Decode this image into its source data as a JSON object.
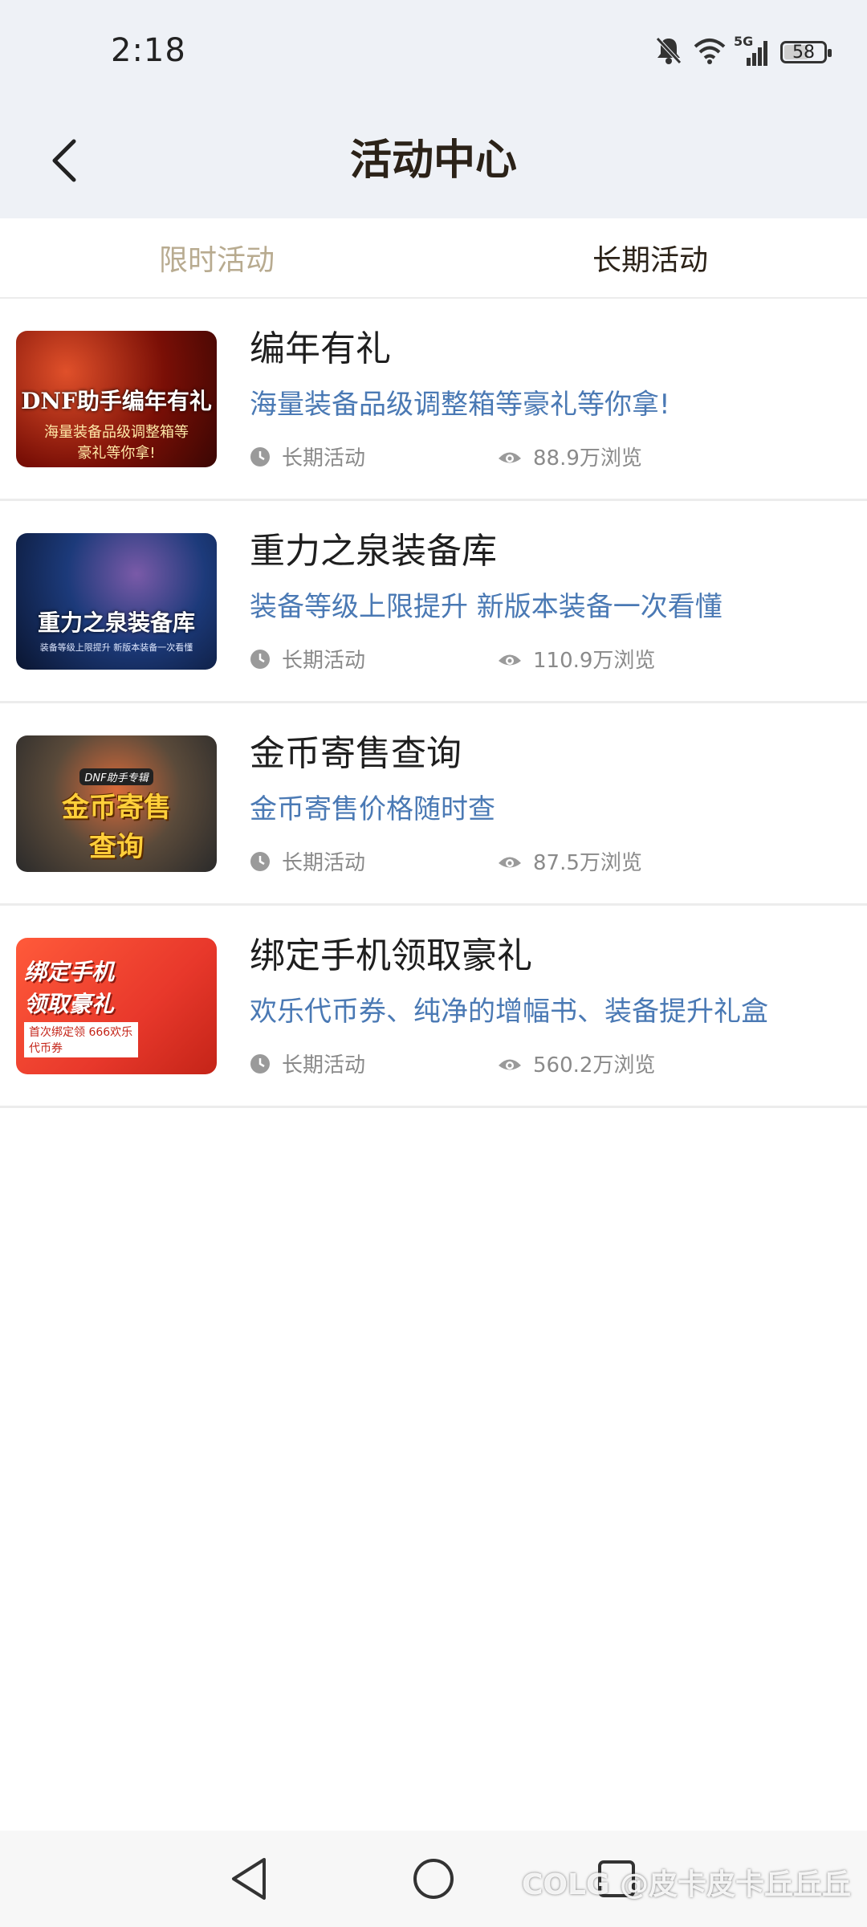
{
  "status": {
    "time": "2:18",
    "network": "5G",
    "battery": "58",
    "battery_level": 0.58
  },
  "header": {
    "title": "活动中心",
    "back_icon": "chevron-left-icon"
  },
  "tabs": [
    {
      "label": "限时活动",
      "active": false
    },
    {
      "label": "长期活动",
      "active": true
    }
  ],
  "items": [
    {
      "title": "编年有礼",
      "desc": "海量装备品级调整箱等豪礼等你拿!",
      "type": "长期活动",
      "views": "88.9万浏览",
      "banner": {
        "line1": "DNF助手编年有礼",
        "line2": "海量装备品级调整箱等",
        "line3": "豪礼等你拿!"
      },
      "colors": {
        "bg1": "#7a0f06",
        "bg2": "#d4361a"
      }
    },
    {
      "title": "重力之泉装备库",
      "desc": "装备等级上限提升 新版本装备一次看懂",
      "type": "长期活动",
      "views": "110.9万浏览",
      "banner": {
        "line1": "重力之泉装备库",
        "line2": "装备等级上限提升 新版本装备一次看懂",
        "line3": ""
      },
      "colors": {
        "bg1": "#0d1e4a",
        "bg2": "#2d5aa8"
      }
    },
    {
      "title": "金币寄售查询",
      "desc": "金币寄售价格随时查",
      "type": "长期活动",
      "views": "87.5万浏览",
      "banner": {
        "line1": "DNF助手专辑",
        "line2": "金币寄售",
        "line3": "查询"
      },
      "colors": {
        "bg1": "#3a3a3a",
        "bg2": "#b08a3c"
      }
    },
    {
      "title": "绑定手机领取豪礼",
      "desc": "欢乐代币券、纯净的增幅书、装备提升礼盒",
      "type": "长期活动",
      "views": "560.2万浏览",
      "banner": {
        "line1": "绑定手机",
        "line2": "领取豪礼",
        "line3": "首次绑定领 666欢乐代币券"
      },
      "colors": {
        "bg1": "#e8382b",
        "bg2": "#ff6a3d"
      }
    }
  ],
  "watermark": "COLG @皮卡皮卡丘丘丘"
}
